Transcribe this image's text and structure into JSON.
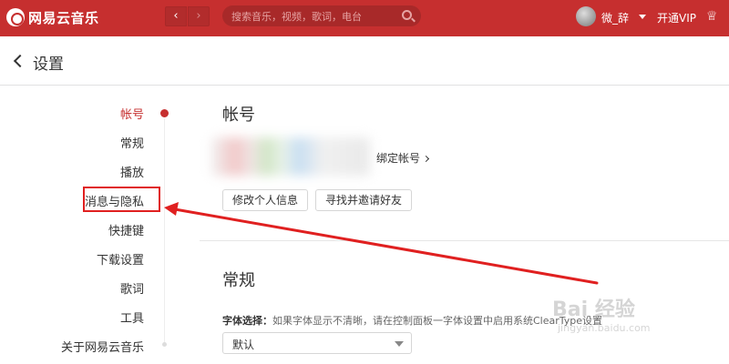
{
  "topbar": {
    "app_name": "网易云音乐",
    "back_symbol": "‹",
    "forward_symbol": "›",
    "search_placeholder": "搜索音乐，视频，歌词，电台",
    "username": "微_辞",
    "vip_label": "开通VIP",
    "shirt_symbol": "♕"
  },
  "header": {
    "title": "设置"
  },
  "sidebar": {
    "items": [
      {
        "label": "帐号",
        "active": true
      },
      {
        "label": "常规",
        "active": false
      },
      {
        "label": "播放",
        "active": false
      },
      {
        "label": "消息与隐私",
        "active": false
      },
      {
        "label": "快捷键",
        "active": false
      },
      {
        "label": "下载设置",
        "active": false
      },
      {
        "label": "歌词",
        "active": false
      },
      {
        "label": "工具",
        "active": false
      },
      {
        "label": "关于网易云音乐",
        "active": false
      }
    ]
  },
  "account": {
    "section_title": "帐号",
    "bind_label": "绑定帐号",
    "edit_button": "修改个人信息",
    "invite_button": "寻找并邀请好友"
  },
  "general": {
    "section_title": "常规",
    "font_label": "字体选择：",
    "font_hint": "如果字体显示不清晰，请在控制面板一字体设置中启用系统ClearType设置",
    "font_value": "默认"
  },
  "watermark": {
    "main": "Bai 经验",
    "sub": "jingyan.baidu.com"
  },
  "colors": {
    "brand": "#c62f2f",
    "annotation": "#e02020"
  }
}
